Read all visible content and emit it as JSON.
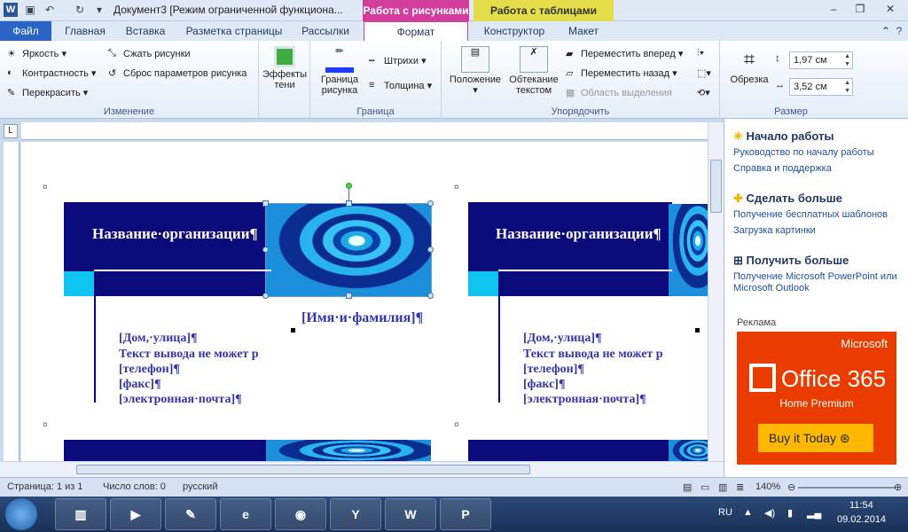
{
  "window": {
    "title": "Документ3 [Режим ограниченной функционa...",
    "context_pictures": "Работа с рисунками",
    "context_tables": "Работа с таблицами"
  },
  "tabs": [
    "Файл",
    "Главная",
    "Вставка",
    "Разметка страницы",
    "Рассылки",
    "Формат",
    "Конструктор",
    "Макет"
  ],
  "ribbon": {
    "change": {
      "brightness": "Яркость",
      "contrast": "Контрастность",
      "recolor": "Перекрасить",
      "compress": "Сжать рисунки",
      "reset": "Сброс параметров рисунка",
      "label": "Изменение"
    },
    "effects": {
      "line1": "Эффекты",
      "line2": "тени"
    },
    "border": {
      "line1": "Граница",
      "line2": "рисунка",
      "dashes": "Штрихи",
      "weight": "Толщина",
      "label": "Граница"
    },
    "arrange": {
      "position": "Положение",
      "wrap1": "Обтекание",
      "wrap2": "текстом",
      "forward": "Переместить вперед",
      "backward": "Переместить назад",
      "selection": "Область выделения",
      "label": "Упорядочить"
    },
    "size": {
      "crop": "Обрезка",
      "height": "1,97 см",
      "width": "3,52 см",
      "label": "Размер"
    }
  },
  "document": {
    "org_name": "Название·организации¶",
    "person": "[Имя·и·фамилия]¶",
    "street": "[Дом,·улица]¶",
    "error": "Текст вывода не может р",
    "phone": "[телефон]¶",
    "fax": "[факс]¶",
    "email": "[электронная·почта]¶"
  },
  "pane": {
    "start_heading": "Начало работы",
    "start_link1": "Руководство по началу работы",
    "start_link2": "Справка и поддержка",
    "more_heading": "Сделать больше",
    "more_link1": "Получение бесплатных шаблонов",
    "more_link2": "Загрузка картинки",
    "get_heading": "Получить больше",
    "get_link1": "Получение Microsoft PowerPoint или",
    "get_link2": "Microsoft Outlook",
    "ad_label": "Реклама",
    "ad_brand": "Microsoft",
    "ad_product": "Office 365",
    "ad_sub": "Home Premium",
    "ad_button": "Buy it Today ⊛"
  },
  "status": {
    "page": "Страница: 1 из 1",
    "words": "Число слов: 0",
    "lang": "русский",
    "zoom": "140%"
  },
  "taskbar": {
    "lang": "RU",
    "time": "11:54",
    "date": "09.02.2014"
  },
  "colors": {
    "card_navy": "#0a0a7a",
    "card_cyan": "#10c4f0",
    "context_pink": "#d33d9b",
    "context_yellow": "#e5dd4a",
    "ad_orange": "#eb3c00"
  }
}
